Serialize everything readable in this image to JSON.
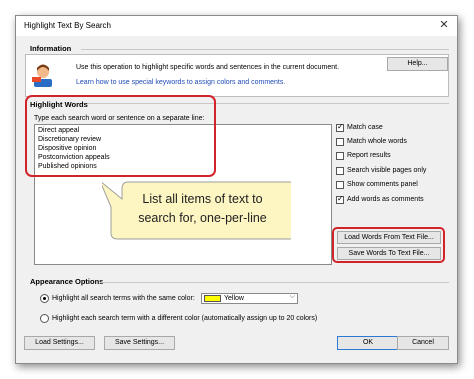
{
  "window": {
    "title": "Highlight Text By Search"
  },
  "information": {
    "label": "Information",
    "text": "Use this operation to highlight specific words and sentences in the current document.",
    "link": "Learn how to use special keywords to assign colors and comments.",
    "help_button": "Help..."
  },
  "highlight_words": {
    "label": "Highlight Words",
    "hint": "Type each search word or sentence on a separate line:",
    "lines": [
      "Direct appeal",
      "Discretionary review",
      "Dispositive opinion",
      "Postconviction appeals",
      "Published opinions"
    ]
  },
  "options": [
    {
      "label": "Match case",
      "checked": true
    },
    {
      "label": "Match whole words",
      "checked": false
    },
    {
      "label": "Report results",
      "checked": false
    },
    {
      "label": "Search visible pages only",
      "checked": false
    },
    {
      "label": "Show comments panel",
      "checked": false
    },
    {
      "label": "Add words as comments",
      "checked": true
    }
  ],
  "callout": {
    "line1": "List all items of text to",
    "line2": "search for, one-per-line"
  },
  "word_file_buttons": {
    "load": "Load Words From Text File...",
    "save": "Save Words To Text File..."
  },
  "appearance": {
    "label": "Appearance Options",
    "radio_same": "Highlight all search terms with the same color:",
    "radio_different": "Highlight each search term with a different color (automatically assign up to 20 colors)",
    "selected": "same",
    "color_value": "Yellow",
    "color_hex": "#ffff00"
  },
  "footer": {
    "load_settings": "Load Settings...",
    "save_settings": "Save Settings...",
    "ok": "OK",
    "cancel": "Cancel"
  }
}
